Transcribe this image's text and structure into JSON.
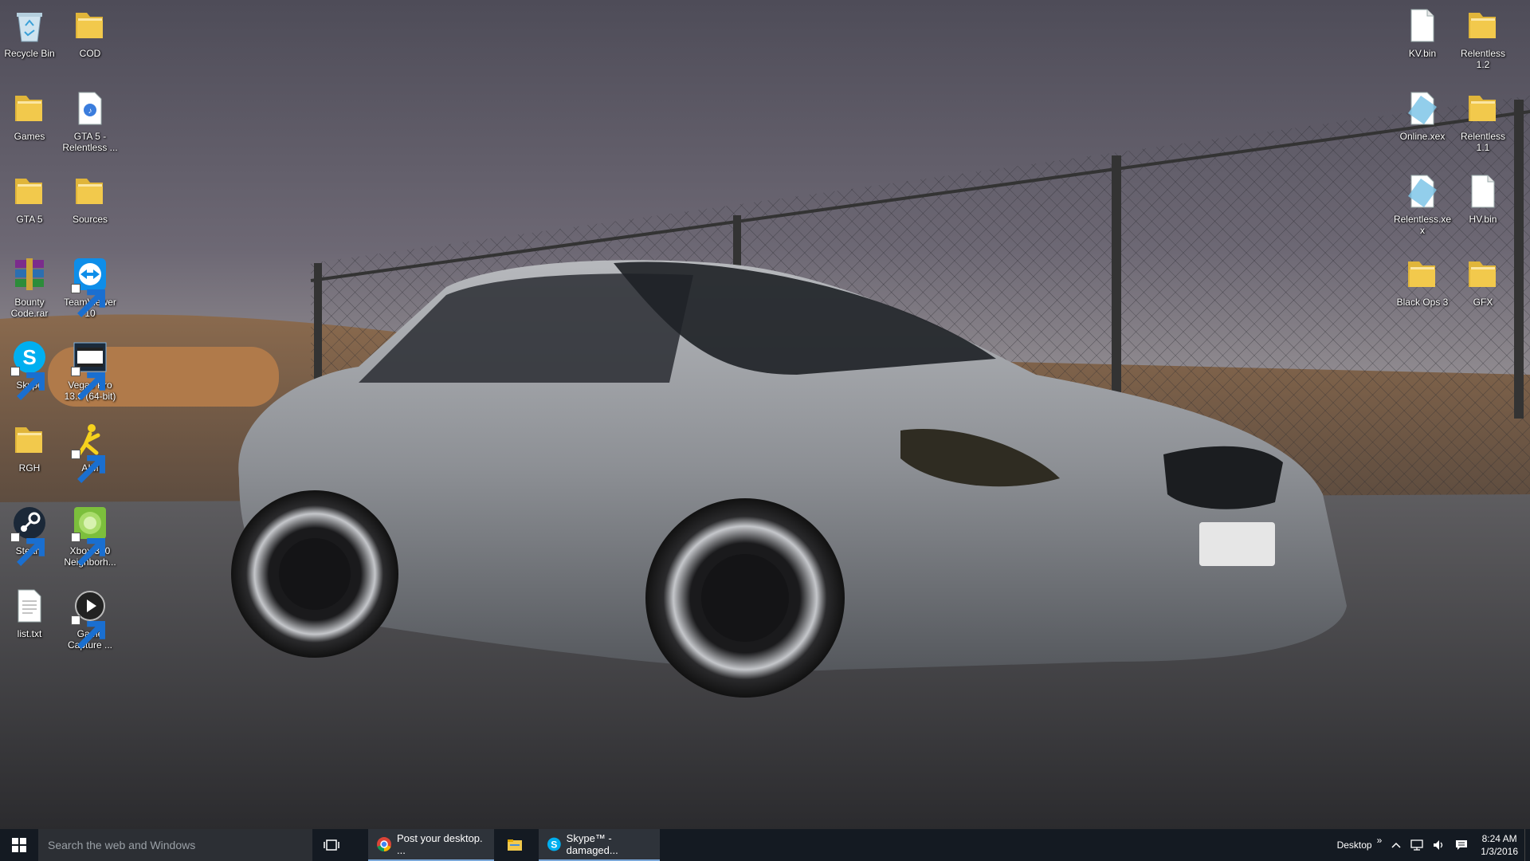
{
  "desktop": {
    "left_icons": [
      {
        "label": "Recycle Bin",
        "icon": "recycle-bin-icon"
      },
      {
        "label": "COD",
        "icon": "folder-icon"
      },
      {
        "label": "Games",
        "icon": "folder-icon"
      },
      {
        "label": "GTA 5 - Relentless ...",
        "icon": "document-icon"
      },
      {
        "label": "GTA 5",
        "icon": "folder-icon"
      },
      {
        "label": "Sources",
        "icon": "folder-icon"
      },
      {
        "label": "Bounty Code.rar",
        "icon": "winrar-archive-icon"
      },
      {
        "label": "TeamViewer 10",
        "icon": "teamviewer-icon"
      },
      {
        "label": "Skype",
        "icon": "skype-icon"
      },
      {
        "label": "Vegas Pro 13.0 (64-bit)",
        "icon": "vegas-pro-icon"
      },
      {
        "label": "RGH",
        "icon": "folder-icon"
      },
      {
        "label": "AIM",
        "icon": "aim-icon"
      },
      {
        "label": "Steam",
        "icon": "steam-icon"
      },
      {
        "label": "Xbox 360 Neighborh...",
        "icon": "xbox-360-icon"
      },
      {
        "label": "list.txt",
        "icon": "text-file-icon"
      },
      {
        "label": "Game Capture ...",
        "icon": "game-capture-icon"
      }
    ],
    "right_icons": [
      {
        "label": "KV.bin",
        "icon": "file-icon"
      },
      {
        "label": "Relentless 1.2",
        "icon": "folder-icon"
      },
      {
        "label": "Online.xex",
        "icon": "xex-file-icon"
      },
      {
        "label": "Relentless 1.1",
        "icon": "folder-icon"
      },
      {
        "label": "Relentless.xex",
        "icon": "xex-file-icon"
      },
      {
        "label": "HV.bin",
        "icon": "file-icon"
      },
      {
        "label": "Black Ops 3",
        "icon": "folder-icon"
      },
      {
        "label": "GFX",
        "icon": "folder-icon"
      }
    ]
  },
  "taskbar": {
    "search_placeholder": "Search the web and Windows",
    "apps": [
      {
        "label": "Post your desktop. ...",
        "icon": "chrome-icon"
      },
      {
        "label": "",
        "icon": "file-explorer-icon"
      },
      {
        "label": "Skype™ - damaged...",
        "icon": "skype-icon"
      }
    ],
    "tray": {
      "desktop_label": "Desktop",
      "overflow": "»",
      "time": "8:24 AM",
      "date": "1/3/2016"
    }
  },
  "colors": {
    "taskbar_bg": "#141a22",
    "search_bg": "#2c2f34",
    "accent": "#7aa7d8",
    "folder_yellow": "#f2c94c"
  }
}
